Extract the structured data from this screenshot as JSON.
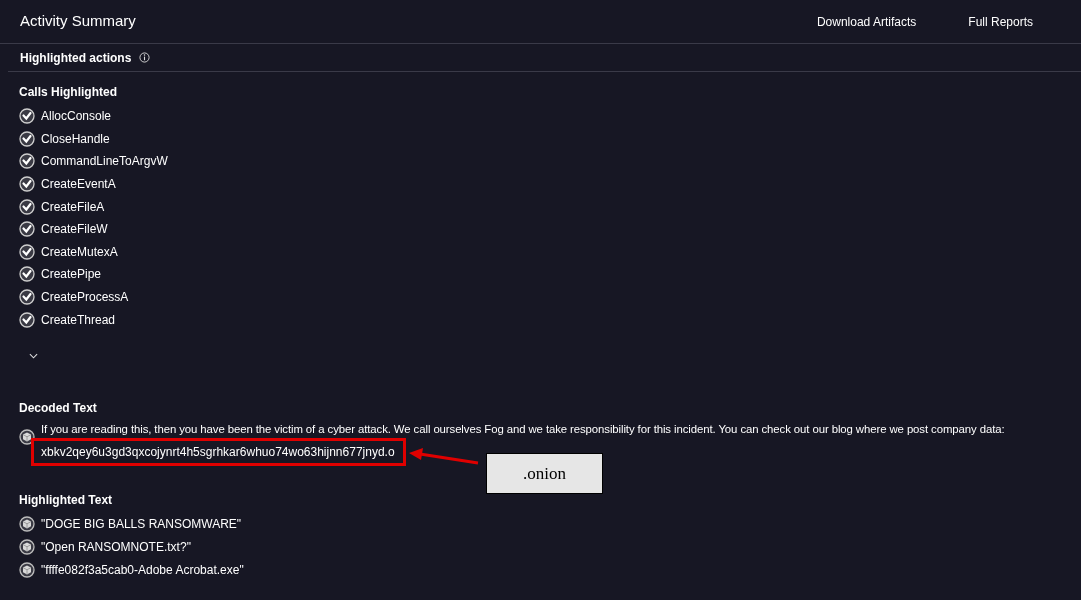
{
  "header": {
    "title": "Activity Summary",
    "links": [
      "Download Artifacts",
      "Full Reports"
    ]
  },
  "highlighted_actions": {
    "title": "Highlighted actions"
  },
  "calls_highlighted": {
    "title": "Calls Highlighted",
    "items": [
      "AllocConsole",
      "CloseHandle",
      "CommandLineToArgvW",
      "CreateEventA",
      "CreateFileA",
      "CreateFileW",
      "CreateMutexA",
      "CreatePipe",
      "CreateProcessA",
      "CreateThread"
    ],
    "expanded": false
  },
  "decoded_text": {
    "title": "Decoded Text",
    "text": "If you are reading this, then you have been the victim of a cyber attack. We call ourselves Fog and we take responsibility for this incident. You can check out our blog where we post company data:",
    "address": "xbkv2qey6u3gd3qxcojynrt4h5sgrhkar6whuo74wo63hijnn677jnyd.o"
  },
  "highlighted_text": {
    "title": "Highlighted Text",
    "items": [
      "\"DOGE BIG BALLS RANSOMWARE\"",
      "\"Open RANSOMNOTE.txt?\"",
      "\"ffffe082f3a5cab0-Adobe Acrobat.exe\""
    ]
  },
  "annotation": {
    "label": ".onion"
  }
}
